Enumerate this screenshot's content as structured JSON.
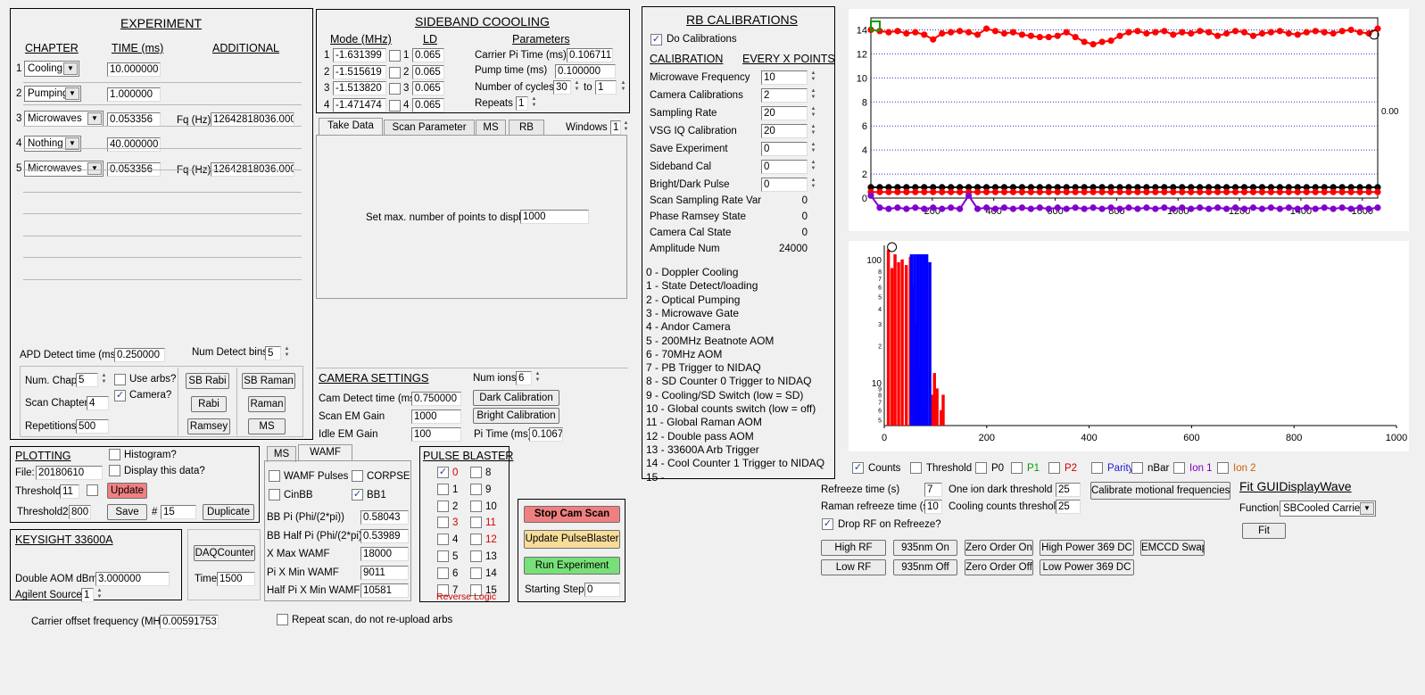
{
  "experiment": {
    "title": "EXPERIMENT",
    "col_chapter": "CHAPTER",
    "col_time": "TIME (ms)",
    "col_additional": "ADDITIONAL",
    "rows": [
      {
        "n": "1",
        "chapter": "Cooling",
        "time": "10.000000",
        "add_label": "",
        "add_value": ""
      },
      {
        "n": "2",
        "chapter": "Pumping",
        "time": "1.000000",
        "add_label": "",
        "add_value": ""
      },
      {
        "n": "3",
        "chapter": "Microwaves",
        "time": "0.053356",
        "add_label": "Fq (Hz)",
        "add_value": "12642818036.000"
      },
      {
        "n": "4",
        "chapter": "Nothing",
        "time": "40.000000",
        "add_label": "",
        "add_value": ""
      },
      {
        "n": "5",
        "chapter": "Microwaves",
        "time": "0.053356",
        "add_label": "Fq (Hz)",
        "add_value": "12642818036.000"
      }
    ],
    "apd_label": "APD Detect time (ms)",
    "apd_value": "0.250000",
    "num_bins_label": "Num Detect bins",
    "num_bins_value": "5",
    "num_chap_label": "Num. Chap",
    "num_chap_value": "5",
    "use_arbs_label": "Use arbs?",
    "camera_label": "Camera?",
    "camera_checked": "✓",
    "scan_chapter_label": "Scan Chapter",
    "scan_chapter_value": "4",
    "repetitions_label": "Repetitions",
    "repetitions_value": "500",
    "btn_sb_rabi": "SB Rabi",
    "btn_sb_raman": "SB Raman",
    "btn_rabi": "Rabi",
    "btn_raman": "Raman",
    "btn_ramsey": "Ramsey",
    "btn_ms": "MS"
  },
  "sideband": {
    "title": "SIDEBAND COOOLING",
    "col_mode": "Mode (MHz)",
    "col_ld": "LD",
    "col_params": "Parameters",
    "rows": [
      {
        "n": "1",
        "mode": "-1.631399",
        "ld_n": "1",
        "ld": "0.065"
      },
      {
        "n": "2",
        "mode": "-1.515619",
        "ld_n": "2",
        "ld": "0.065"
      },
      {
        "n": "3",
        "mode": "-1.513820",
        "ld_n": "3",
        "ld": "0.065"
      },
      {
        "n": "4",
        "mode": "-1.471474",
        "ld_n": "4",
        "ld": "0.065"
      }
    ],
    "carrier_pi_label": "Carrier Pi Time (ms)",
    "carrier_pi_value": "0.106711",
    "pump_time_label": "Pump time (ms)",
    "pump_time_value": "0.100000",
    "cycles_label": "Number of cycles",
    "cycles_from": "30",
    "cycles_to_label": "to",
    "cycles_to": "1",
    "repeats_label": "Repeats",
    "repeats_value": "1"
  },
  "tabs": {
    "items": [
      "Take Data",
      "Scan Parameter",
      "MS",
      "RB"
    ],
    "windows_label": "Windows",
    "windows_value": "1",
    "max_points_label": "Set max. number of points to display",
    "max_points_value": "1000"
  },
  "camera": {
    "title": "CAMERA SETTINGS",
    "num_ions_label": "Num ions",
    "num_ions_value": "6",
    "detect_label": "Cam Detect time (ms)",
    "detect_value": "0.750000",
    "scan_em_label": "Scan EM Gain",
    "scan_em_value": "1000",
    "idle_em_label": "Idle EM Gain",
    "idle_em_value": "100",
    "btn_dark": "Dark Calibration",
    "btn_bright": "Bright Calibration",
    "pi_time_label": "Pi Time (ms)",
    "pi_time_value": "0.1067"
  },
  "rb": {
    "title": "RB CALIBRATIONS",
    "do_cal_label": "Do Calibrations",
    "do_cal_checked": "✓",
    "col_cal": "CALIBRATION",
    "col_every": "EVERY X POINTS",
    "fields": [
      {
        "label": "Microwave Frequency",
        "value": "10"
      },
      {
        "label": "Camera Calibrations",
        "value": "2"
      },
      {
        "label": "Sampling Rate",
        "value": "20"
      },
      {
        "label": "VSG IQ Calibration",
        "value": "20"
      },
      {
        "label": "Save Experiment",
        "value": "0"
      },
      {
        "label": "Sideband Cal",
        "value": "0"
      },
      {
        "label": "Bright/Dark Pulse",
        "value": "0"
      }
    ],
    "states": [
      {
        "label": "Scan Sampling Rate Var",
        "value": "0"
      },
      {
        "label": "Phase Ramsey State",
        "value": "0"
      },
      {
        "label": "Camera Cal State",
        "value": "0"
      },
      {
        "label": "Amplitude Num",
        "value": "24000"
      }
    ],
    "channels": [
      "0 - Doppler Cooling",
      "1 - State Detect/loading",
      "2 - Optical Pumping",
      "3 - Microwave Gate",
      "4 - Andor Camera",
      "5 - 200MHz Beatnote AOM",
      "6 - 70MHz AOM",
      "7 - PB Trigger to NIDAQ",
      "8 - SD Counter 0 Trigger to NIDAQ",
      "9 - Cooling/SD Switch (low = SD)",
      "10 - Global counts switch (low = off)",
      "11 - Global Raman AOM",
      "12 - Double pass AOM",
      "13 - 33600A Arb Trigger",
      "14 - Cool Counter 1 Trigger to NIDAQ",
      "15 -"
    ]
  },
  "plotting": {
    "title": "PLOTTING",
    "histogram_label": "Histogram?",
    "file_label": "File:",
    "file_value": "20180610",
    "display_label": "Display this data?",
    "threshold_label": "Threshold",
    "threshold_value": "11",
    "btn_update": "Update",
    "threshold2_label": "Threshold2",
    "threshold2_value": "800",
    "btn_save": "Save",
    "hash_label": "#",
    "hash_value": "15",
    "btn_duplicate": "Duplicate"
  },
  "keysight": {
    "title": "KEYSIGHT 33600A",
    "aom_label": "Double AOM dBm",
    "aom_value": "3.000000",
    "agilent_label": "Agilent Source",
    "agilent_value": "1"
  },
  "daq": {
    "btn": "DAQCounter",
    "time_label": "Time",
    "time_value": "1500"
  },
  "carrier_offset": {
    "label": "Carrier offset frequency (MHz)",
    "value": "0.00591753"
  },
  "wamf": {
    "tabs": [
      "MS",
      "WAMF"
    ],
    "wamf_pulses": "WAMF Pulses",
    "corpse": "CORPSE",
    "cinbb": "CinBB",
    "bb1": "BB1",
    "bb1_checked": "✓",
    "fields": [
      {
        "label": "BB Pi (Phi/(2*pi))",
        "value": "0.58043"
      },
      {
        "label": "BB Half Pi (Phi/(2*pi))",
        "value": "0.53989"
      },
      {
        "label": "X Max WAMF",
        "value": "18000"
      },
      {
        "label": "Pi X Min WAMF",
        "value": "9011"
      },
      {
        "label": "Half Pi X Min WAMF",
        "value": "10581"
      }
    ]
  },
  "repeat_scan": "Repeat scan, do not re-upload arbs",
  "pulse_blaster": {
    "title": "PULSE BLASTER",
    "left": [
      {
        "n": "0",
        "c": "✓",
        "color": "#d00000"
      },
      {
        "n": "1",
        "c": "",
        "color": "#000"
      },
      {
        "n": "2",
        "c": "",
        "color": "#000"
      },
      {
        "n": "3",
        "c": "",
        "color": "#d00000"
      },
      {
        "n": "4",
        "c": "",
        "color": "#000"
      },
      {
        "n": "5",
        "c": "",
        "color": "#000"
      },
      {
        "n": "6",
        "c": "",
        "color": "#000"
      },
      {
        "n": "7",
        "c": "",
        "color": "#000"
      }
    ],
    "right": [
      {
        "n": "8",
        "color": "#000"
      },
      {
        "n": "9",
        "color": "#000"
      },
      {
        "n": "10",
        "color": "#000"
      },
      {
        "n": "11",
        "color": "#d00000"
      },
      {
        "n": "12",
        "color": "#d00000"
      },
      {
        "n": "13",
        "color": "#000"
      },
      {
        "n": "14",
        "color": "#000"
      },
      {
        "n": "15",
        "color": "#000"
      }
    ],
    "reverse": "Reverse Logic"
  },
  "run": {
    "btn_stop": "Stop Cam Scan",
    "btn_update_pb": "Update PulseBlaster",
    "btn_run": "Run Experiment",
    "start_label": "Starting Step",
    "start_value": "0"
  },
  "legend": [
    {
      "label": "Counts",
      "checked": "✓",
      "color": "#000"
    },
    {
      "label": "Threshold",
      "checked": "",
      "color": "#000"
    },
    {
      "label": "P0",
      "checked": "",
      "color": "#000"
    },
    {
      "label": "P1",
      "checked": "",
      "color": "#00a000"
    },
    {
      "label": "P2",
      "checked": "",
      "color": "#d00000"
    },
    {
      "label": "Parity",
      "checked": "",
      "color": "#2020d0"
    },
    {
      "label": "nBar",
      "checked": "",
      "color": "#000"
    },
    {
      "label": "Ion 1",
      "checked": "",
      "color": "#8000c0"
    },
    {
      "label": "Ion 2",
      "checked": "",
      "color": "#d06000"
    }
  ],
  "refreeze": {
    "time_label": "Refreeze time (s)",
    "time_value": "7",
    "dark_label": "One ion dark threshold",
    "dark_value": "25",
    "raman_label": "Raman refreeze time (s)",
    "raman_value": "10",
    "cooling_label": "Cooling counts threshold",
    "cooling_value": "25",
    "btn_calibrate": "Calibrate motional frequencies",
    "drop_label": "Drop RF on Refreeze?",
    "drop_checked": "✓"
  },
  "fit": {
    "title": "Fit GUIDisplayWave",
    "function_label": "Function",
    "function_value": "SBCooled Carrier",
    "btn_fit": "Fit"
  },
  "controls": {
    "btn_high_rf": "High RF",
    "btn_low_rf": "Low RF",
    "btn_935_on": "935nm On",
    "btn_935_off": "935nm Off",
    "btn_zero_on": "Zero Order On",
    "btn_zero_off": "Zero Order Off",
    "btn_hp369": "High Power 369 DC",
    "btn_lp369": "Low Power 369 DC",
    "btn_emccd": "EMCCD Swap"
  },
  "colors": {
    "red": "#ff0000",
    "blue": "#0000ff",
    "purple": "#8000d0",
    "btn_red": "#f08080",
    "btn_yellow": "#f7dc9a",
    "btn_green": "#78e078"
  },
  "chart_data": [
    {
      "type": "scatter",
      "x_ticks": [
        "200",
        "400",
        "600",
        "800",
        "1000",
        "1200",
        "1400",
        "1600"
      ],
      "y_ticks": [
        "0",
        "2",
        "4",
        "6",
        "8",
        "10",
        "12",
        "14"
      ],
      "ylim": [
        0,
        15
      ],
      "xlim": [
        0,
        1650
      ],
      "side_value": "0.00",
      "series": [
        {
          "color": "#ff0000",
          "values": [
            14.0,
            13.9,
            13.8,
            13.9,
            13.7,
            13.8,
            13.6,
            13.2,
            13.7,
            13.8,
            13.9,
            13.8,
            13.6,
            14.1,
            13.9,
            13.7,
            13.8,
            13.6,
            13.5,
            13.4,
            13.4,
            13.5,
            13.8,
            13.4,
            13.0,
            12.8,
            13.0,
            13.1,
            13.5,
            13.8,
            13.9,
            13.7,
            13.8,
            13.9,
            13.6,
            13.8,
            13.7,
            13.9,
            13.8,
            13.5,
            13.7,
            13.9,
            13.8,
            13.5,
            13.7,
            13.8,
            13.9,
            13.7,
            13.6,
            13.8,
            13.9,
            13.8,
            13.7,
            13.9,
            14.0,
            13.8,
            13.7,
            14.1
          ]
        },
        {
          "color": "#000000",
          "values": [
            0.9,
            0.9,
            0.9,
            0.9,
            0.9,
            0.9,
            0.9,
            0.9,
            0.9,
            0.9,
            0.9,
            0.9,
            0.9,
            0.9,
            0.9,
            0.9,
            0.9,
            0.9,
            0.9,
            0.9,
            0.9,
            0.9,
            0.9,
            0.9,
            0.9,
            0.9,
            0.9,
            0.9,
            0.9,
            0.9,
            0.9,
            0.9,
            0.9,
            0.9,
            0.9,
            0.9,
            0.9,
            0.9,
            0.9,
            0.9,
            0.9,
            0.9,
            0.9,
            0.9,
            0.9,
            0.9,
            0.9,
            0.9,
            0.9,
            0.9,
            0.9,
            0.9,
            0.9,
            0.9,
            0.9,
            0.9,
            0.9,
            0.9
          ]
        },
        {
          "color": "#ff0000",
          "values": [
            0.5,
            0.5,
            0.5,
            0.5,
            0.5,
            0.5,
            0.5,
            0.5,
            0.5,
            0.5,
            0.5,
            0.5,
            0.5,
            0.5,
            0.5,
            0.5,
            0.5,
            0.5,
            0.5,
            0.5,
            0.5,
            0.5,
            0.5,
            0.5,
            0.5,
            0.5,
            0.5,
            0.5,
            0.5,
            0.5,
            0.5,
            0.5,
            0.5,
            0.5,
            0.5,
            0.5,
            0.5,
            0.5,
            0.5,
            0.5,
            0.5,
            0.5,
            0.5,
            0.5,
            0.5,
            0.5,
            0.5,
            0.5,
            0.5,
            0.5,
            0.5,
            0.5,
            0.5,
            0.5,
            0.5,
            0.5,
            0.5,
            0.5
          ]
        },
        {
          "color": "#8000d0",
          "values": [
            0.2,
            -0.8,
            -0.9,
            -0.8,
            -0.9,
            -0.8,
            -0.9,
            -0.8,
            -0.9,
            -0.8,
            -0.9,
            0.2,
            -0.9,
            -0.8,
            -0.9,
            -0.8,
            -0.9,
            -0.8,
            -0.9,
            -0.8,
            -0.9,
            -0.8,
            -0.9,
            -0.8,
            -0.9,
            -0.8,
            -0.9,
            -0.8,
            -0.9,
            -0.8,
            -0.9,
            -0.8,
            -0.9,
            -0.8,
            -0.9,
            -0.8,
            -0.9,
            -0.8,
            -0.9,
            -0.8,
            -0.9,
            -0.8,
            -0.9,
            -0.8,
            -0.9,
            -0.8,
            -0.9,
            -0.8,
            -0.9,
            -0.8,
            -0.9,
            -0.8,
            -0.9,
            -0.8,
            -0.9,
            -0.8,
            -0.9,
            -0.8
          ]
        }
      ]
    },
    {
      "type": "bar",
      "x_ticks": [
        "0",
        "200",
        "400",
        "600",
        "800",
        "1000"
      ],
      "y_ticks": [
        "100",
        "10"
      ],
      "y_minor": [
        "8",
        "7",
        "6",
        "5",
        "4",
        "3",
        "2",
        "9",
        "8",
        "7",
        "6",
        "5"
      ],
      "xlim": [
        0,
        1000
      ],
      "log": true,
      "series": [
        {
          "color": "#ff0000",
          "bins": [
            [
              5,
              120
            ],
            [
              12,
              85
            ],
            [
              18,
              110
            ],
            [
              25,
              95
            ],
            [
              32,
              100
            ],
            [
              40,
              90
            ],
            [
              48,
              105
            ],
            [
              55,
              60
            ],
            [
              60,
              30
            ],
            [
              65,
              12
            ],
            [
              70,
              6
            ],
            [
              78,
              110
            ],
            [
              90,
              8
            ],
            [
              95,
              12
            ],
            [
              100,
              9
            ],
            [
              108,
              6
            ],
            [
              112,
              8
            ]
          ]
        },
        {
          "color": "#0000ff",
          "bins": [
            [
              50,
              110
            ],
            [
              56,
              110
            ],
            [
              62,
              110
            ],
            [
              68,
              110
            ],
            [
              74,
              110
            ],
            [
              80,
              110
            ],
            [
              86,
              95
            ]
          ]
        }
      ]
    }
  ]
}
